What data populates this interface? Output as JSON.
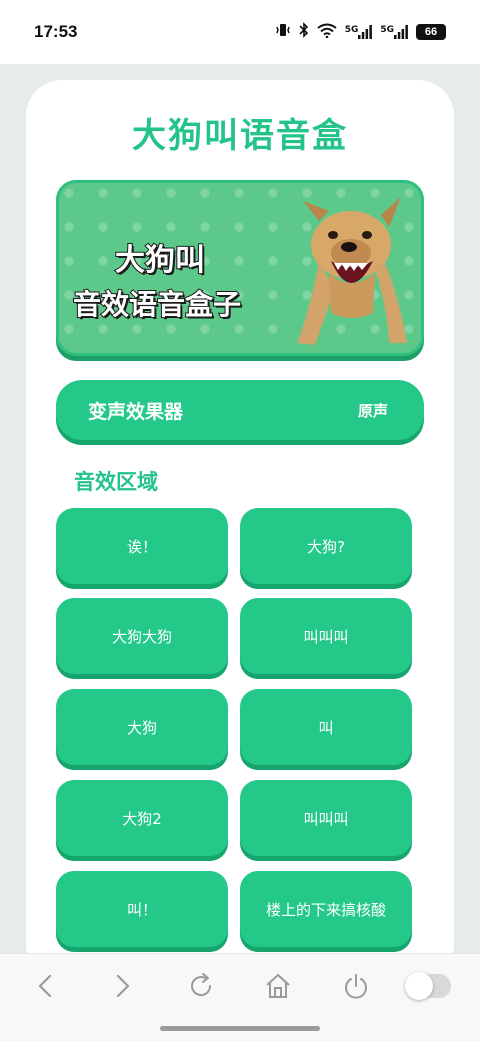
{
  "status_bar": {
    "time": "17:53",
    "network_label": "5G",
    "network_label_2": "5G",
    "battery": "66"
  },
  "app": {
    "title": "大狗叫语音盒"
  },
  "banner": {
    "line1": "大狗叫",
    "line2": "音效语音盒子"
  },
  "voice_changer": {
    "label": "变声效果器",
    "value": "原声"
  },
  "sound_section": {
    "title": "音效区域",
    "items": [
      "诶！",
      "大狗?",
      "大狗大狗",
      "叫叫叫",
      "大狗",
      "叫",
      "大狗2",
      "叫叫叫",
      "叫！",
      "楼上的下来搞核酸"
    ]
  },
  "bottom_nav": {
    "icons": [
      "back-icon",
      "forward-icon",
      "refresh-icon",
      "home-icon",
      "power-icon",
      "toggle-switch"
    ]
  },
  "colors": {
    "accent": "#24c98a",
    "accent_shadow": "#17a56e",
    "title": "#24c38a"
  }
}
